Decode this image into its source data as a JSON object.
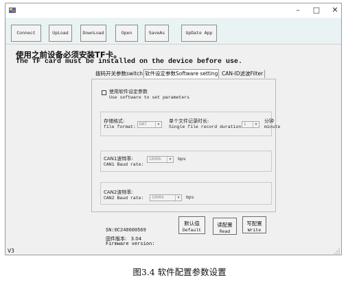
{
  "window": {
    "status_text": "V3"
  },
  "toolbar": {
    "buttons": [
      "Connect",
      "UpLoad",
      "DownLoad",
      "Open",
      "SaveAs",
      "UpDate App"
    ]
  },
  "warning": {
    "cn": "使用之前设备必须安装TF卡。",
    "en": "The TF card must be installed on the device before use."
  },
  "tabs": [
    "拨码开关参数switch",
    "软件设定参数Software setting",
    "CAN-ID滤波Filter"
  ],
  "active_tab": 1,
  "software_setting": {
    "use_software_cn": "使用软件设定参数",
    "use_software_en": "Use software to set parameters",
    "checked": false,
    "file_format_cn": "存储格式:",
    "file_format_en": "file format:",
    "file_format_value": "DAT",
    "record_duration_cn": "单个文件记录时长:",
    "record_duration_en": "Single file record duration:",
    "record_duration_value": "1",
    "minute_cn": "分钟",
    "minute_en": "minute",
    "can1_cn": "CAN1波特率:",
    "can1_en": "CAN1 Baud rate:",
    "can1_value": "1000k",
    "can2_cn": "CAN2波特率:",
    "can2_en": "CAN2 Baud rate:",
    "can2_value": "1000k",
    "bps": "bps"
  },
  "actions": {
    "default_cn": "默认值",
    "default_en": "Default",
    "read_cn": "读配置",
    "read_en": "Read",
    "write_cn": "写配置",
    "write_en": "Write"
  },
  "device_info": {
    "sn": "SN:0C240600569",
    "fw_cn": "固件版本:",
    "fw_value": "3.04",
    "fw_en": "Firmware version:"
  },
  "caption": "图3.4    软件配置参数设置"
}
